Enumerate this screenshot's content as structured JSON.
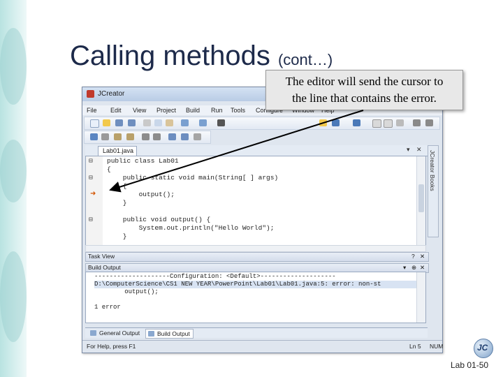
{
  "slide": {
    "title_main": "Calling methods",
    "title_sub": "(cont…)",
    "callout_line1": "The editor will send the cursor to",
    "callout_line2": "the line that contains the error.",
    "page_number": "Lab 01-50",
    "logo_text": "JC"
  },
  "window": {
    "title": "JCreator",
    "menu": [
      "File",
      "Edit",
      "View",
      "Project",
      "Build",
      "Run",
      "Tools",
      "Configure",
      "Window",
      "Help"
    ],
    "tab": "Lab01.java",
    "side_pane": "JCreator Books",
    "task_view": "Task View",
    "build_output_header": "Build Output",
    "code_lines": [
      "public class Lab01",
      "{",
      "    public static void main(String[ ] args)",
      "    {",
      "        output();",
      "    }",
      "",
      "    public void output() {",
      "        System.out.println(\"Hello World\");",
      "    }"
    ],
    "output_lines": [
      "--------------------Configuration: <Default>--------------------",
      "D:\\ComputerScience\\CS1 NEW YEAR\\PowerPoint\\Lab01\\Lab01.java:5: error: non-st",
      "        output();",
      "",
      "1 error"
    ],
    "output_tabs": [
      "General Output",
      "Build Output"
    ],
    "status_left": "For Help, press F1",
    "status_right": "Ln 5",
    "status_mode": "NUM"
  }
}
